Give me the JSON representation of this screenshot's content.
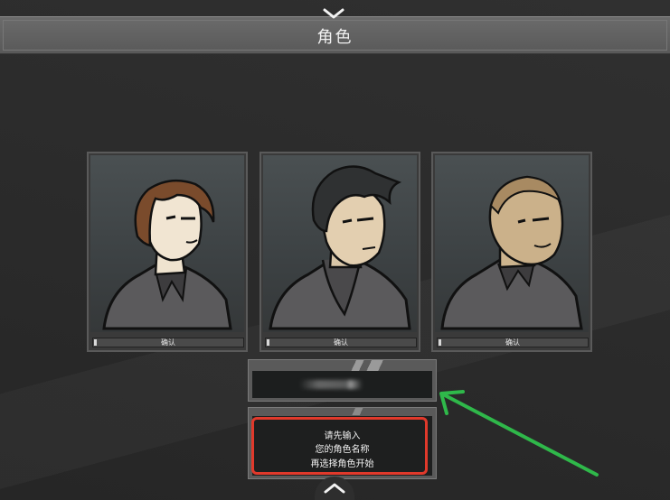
{
  "header": {
    "title": "角色"
  },
  "characters": [
    {
      "id": "brown-hair",
      "confirm_label": "确认"
    },
    {
      "id": "black-hair",
      "confirm_label": "确认"
    },
    {
      "id": "bald",
      "confirm_label": "确认"
    }
  ],
  "name_input": {
    "value": "",
    "placeholder": ""
  },
  "message": {
    "lines": [
      "请先输入",
      "您的角色名称",
      "再选择角色开始"
    ]
  },
  "colors": {
    "highlight": "#e0392b",
    "arrow": "#2fb84a",
    "header": "#5f5f5f"
  },
  "icons": {
    "top": "chevron-down-icon",
    "bottom": "chevron-up-icon"
  }
}
